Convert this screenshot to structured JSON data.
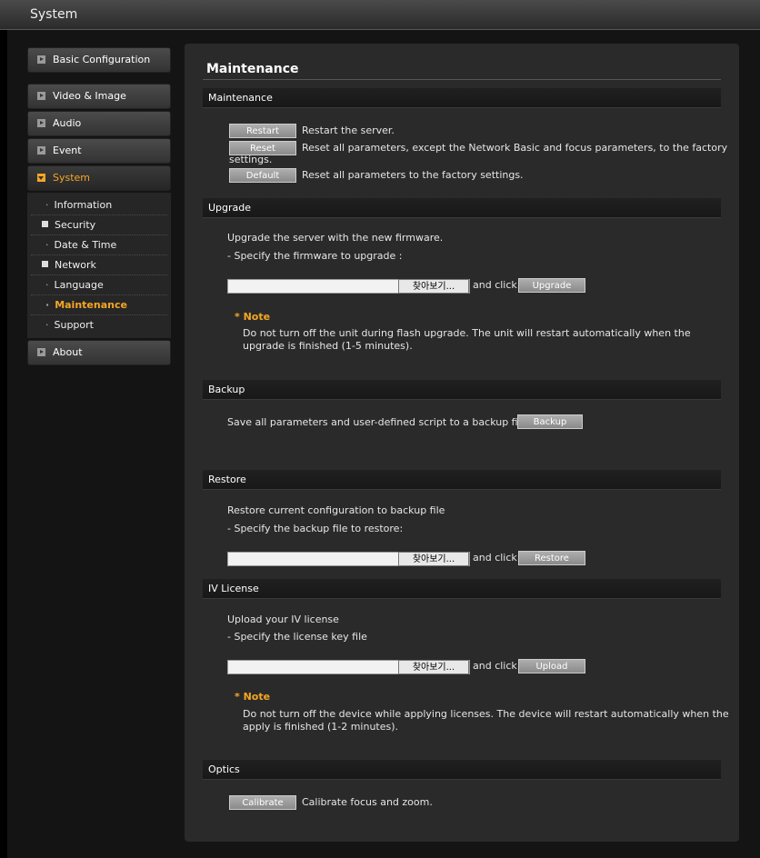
{
  "window": {
    "title": "System"
  },
  "sidebar": {
    "top_items": [
      {
        "label": "Basic Configuration"
      },
      {
        "label": "Video & Image"
      },
      {
        "label": "Audio"
      },
      {
        "label": "Event"
      },
      {
        "label": "System"
      }
    ],
    "sub_items": [
      {
        "label": "Information"
      },
      {
        "label": "Security"
      },
      {
        "label": "Date & Time"
      },
      {
        "label": "Network"
      },
      {
        "label": "Language"
      },
      {
        "label": "Maintenance"
      },
      {
        "label": "Support"
      }
    ],
    "bottom_item": {
      "label": "About"
    }
  },
  "main": {
    "title": "Maintenance",
    "maintenance": {
      "header": "Maintenance",
      "restart_label": "Restart",
      "restart_desc": "Restart the server.",
      "reset_label": "Reset",
      "reset_desc_1": "Reset all parameters, except the Network Basic and focus parameters, to the factory",
      "reset_desc_2": "settings.",
      "default_label": "Default",
      "default_desc": "Reset all parameters to the factory settings."
    },
    "upgrade": {
      "header": "Upgrade",
      "line1": "Upgrade the server with the new firmware.",
      "line2": "- Specify the firmware to upgrade :",
      "browse_label": "찾아보기...",
      "and_click": "and click",
      "button_label": "Upgrade",
      "note_head": "* Note",
      "note_1": "Do not turn off the unit during flash upgrade. The unit will restart automatically when the",
      "note_2": "upgrade is finished (1-5 minutes)."
    },
    "backup": {
      "header": "Backup",
      "line": "Save all parameters and user-defined script to a backup file.",
      "button_label": "Backup"
    },
    "restore": {
      "header": "Restore",
      "line1": "Restore current configuration to backup file",
      "line2": "- Specify the backup file to restore:",
      "browse_label": "찾아보기...",
      "and_click": "and click",
      "button_label": "Restore"
    },
    "license": {
      "header": "IV License",
      "line1": "Upload your IV license",
      "line2": "- Specify the license key file",
      "browse_label": "찾아보기...",
      "and_click": "and click",
      "button_label": "Upload",
      "note_head": "* Note",
      "note_1": "Do not turn off the device while applying licenses. The device will restart automatically when the",
      "note_2": "apply is finished (1-2 minutes)."
    },
    "optics": {
      "header": "Optics",
      "button_label": "Calibrate",
      "desc": "Calibrate focus and zoom."
    }
  }
}
